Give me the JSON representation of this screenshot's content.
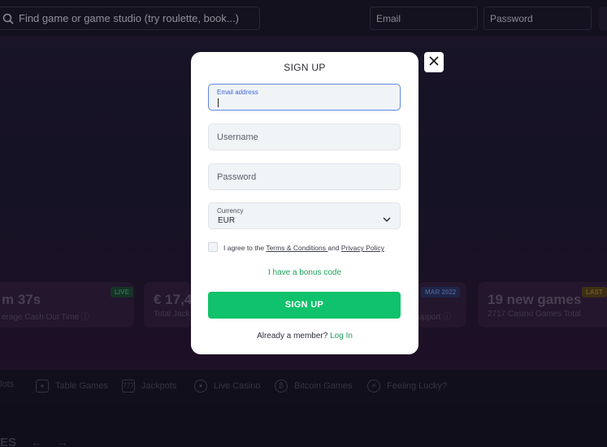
{
  "header": {
    "search_placeholder": "Find game or game studio (try roulette, book...)",
    "email_placeholder": "Email",
    "password_placeholder": "Password"
  },
  "stats": [
    {
      "big": "m 37s",
      "small": "erage Cash Out Time ⓘ",
      "badge": "LIVE",
      "badge_color": "#1f7a4a"
    },
    {
      "big": "€ 17,4",
      "small": "Total Jack",
      "badge": "",
      "badge_color": ""
    },
    {
      "big": "",
      "small": "upport ⓘ",
      "badge": "MAR 2022",
      "badge_color": "#2d3f86"
    },
    {
      "big": "19 new games",
      "small": "2717 Casino Games Total",
      "badge": "LAST",
      "badge_color": "#8a6a1a"
    }
  ],
  "categories": [
    {
      "label": "lots",
      "icon": "slots-icon"
    },
    {
      "label": "Table Games",
      "icon": "cards-icon"
    },
    {
      "label": "Jackpots",
      "icon": "jackpot-icon"
    },
    {
      "label": "Live Casino",
      "icon": "live-icon"
    },
    {
      "label": "Bitcoin Games",
      "icon": "bitcoin-icon"
    },
    {
      "label": "Feeling Lucky?",
      "icon": "lucky-icon"
    }
  ],
  "bottom": {
    "title": "ES"
  },
  "modal": {
    "title": "SIGN UP",
    "email_label": "Email address",
    "username_placeholder": "Username",
    "password_placeholder": "Password",
    "currency_label": "Currency",
    "currency_value": "EUR",
    "agree_prefix": "I agree to the ",
    "terms": "Terms & Conditions ",
    "agree_and": "and ",
    "privacy": "Privacy Policy",
    "bonus_link": "I have a bonus code",
    "signup_button": "SIGN UP",
    "member_prefix": "Already a member? ",
    "login_link": "Log In"
  },
  "colors": {
    "accent_green": "#0fc26b",
    "link_green": "#1fa05e",
    "focus_blue": "#5f86e6"
  }
}
